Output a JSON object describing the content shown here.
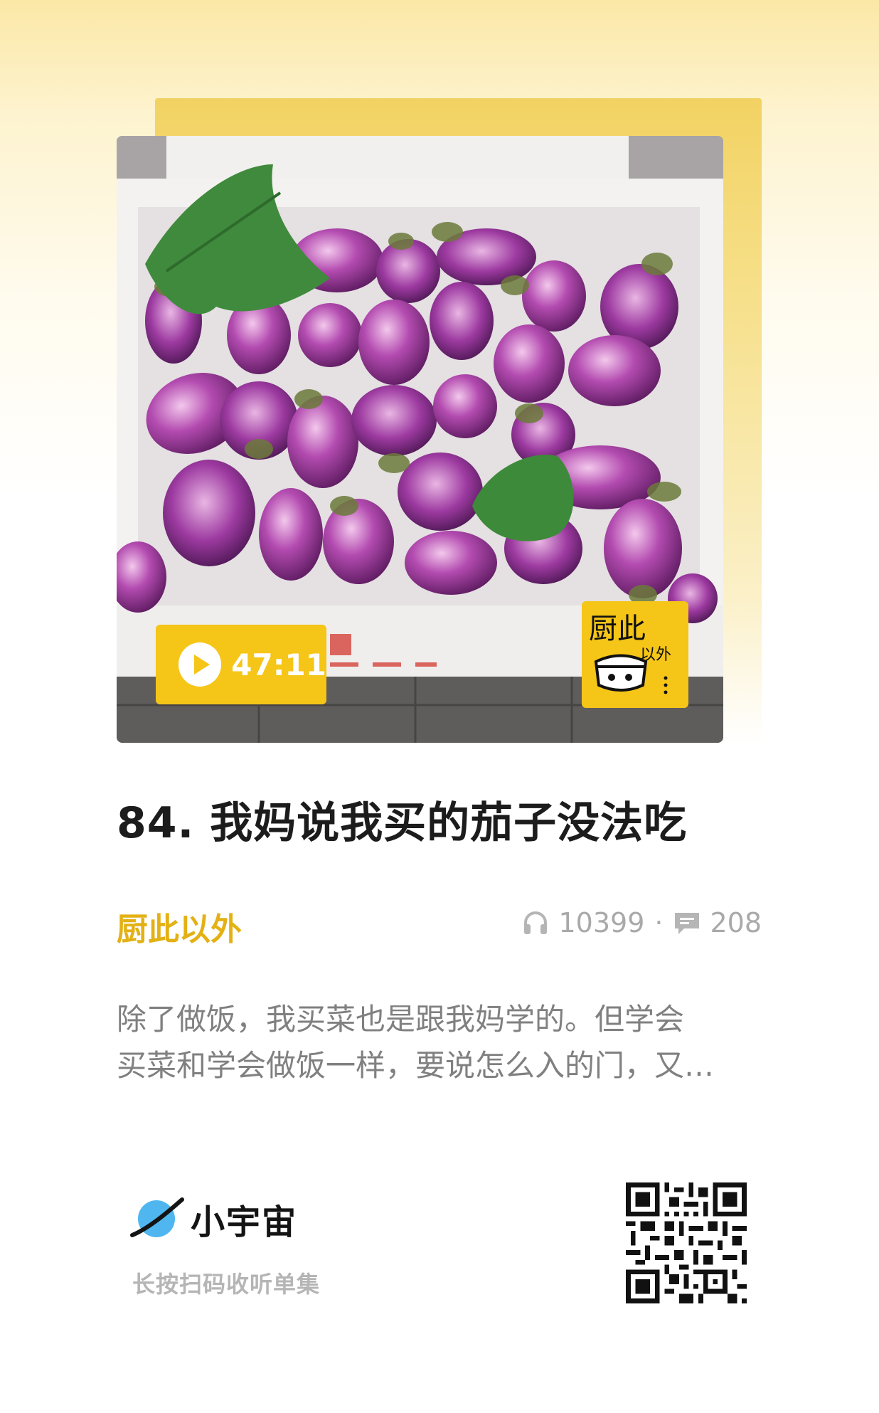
{
  "episode": {
    "duration": "47:11",
    "title": "84. 我妈说我买的茄子没法吃"
  },
  "podcast": {
    "name": "厨此以外",
    "logo_text": [
      "厨此",
      "以外"
    ],
    "listens": "10399",
    "separator": "·",
    "comments": "208"
  },
  "description": {
    "line1": "除了做饭，我买菜也是跟我妈学的。但学会",
    "line2": "买菜和学会做饭一样，要说怎么入的门，又…"
  },
  "footer": {
    "brand": "小宇宙",
    "hint": "长按扫码收听单集"
  },
  "icons": {
    "play": "play-icon",
    "listens": "headphones-icon",
    "comments": "comment-icon",
    "brand": "planet-icon",
    "qr": "qr-code"
  },
  "colors": {
    "accent": "#f5c518",
    "podcast_name": "#e3b115",
    "eggplant": "#8b2f8f"
  }
}
